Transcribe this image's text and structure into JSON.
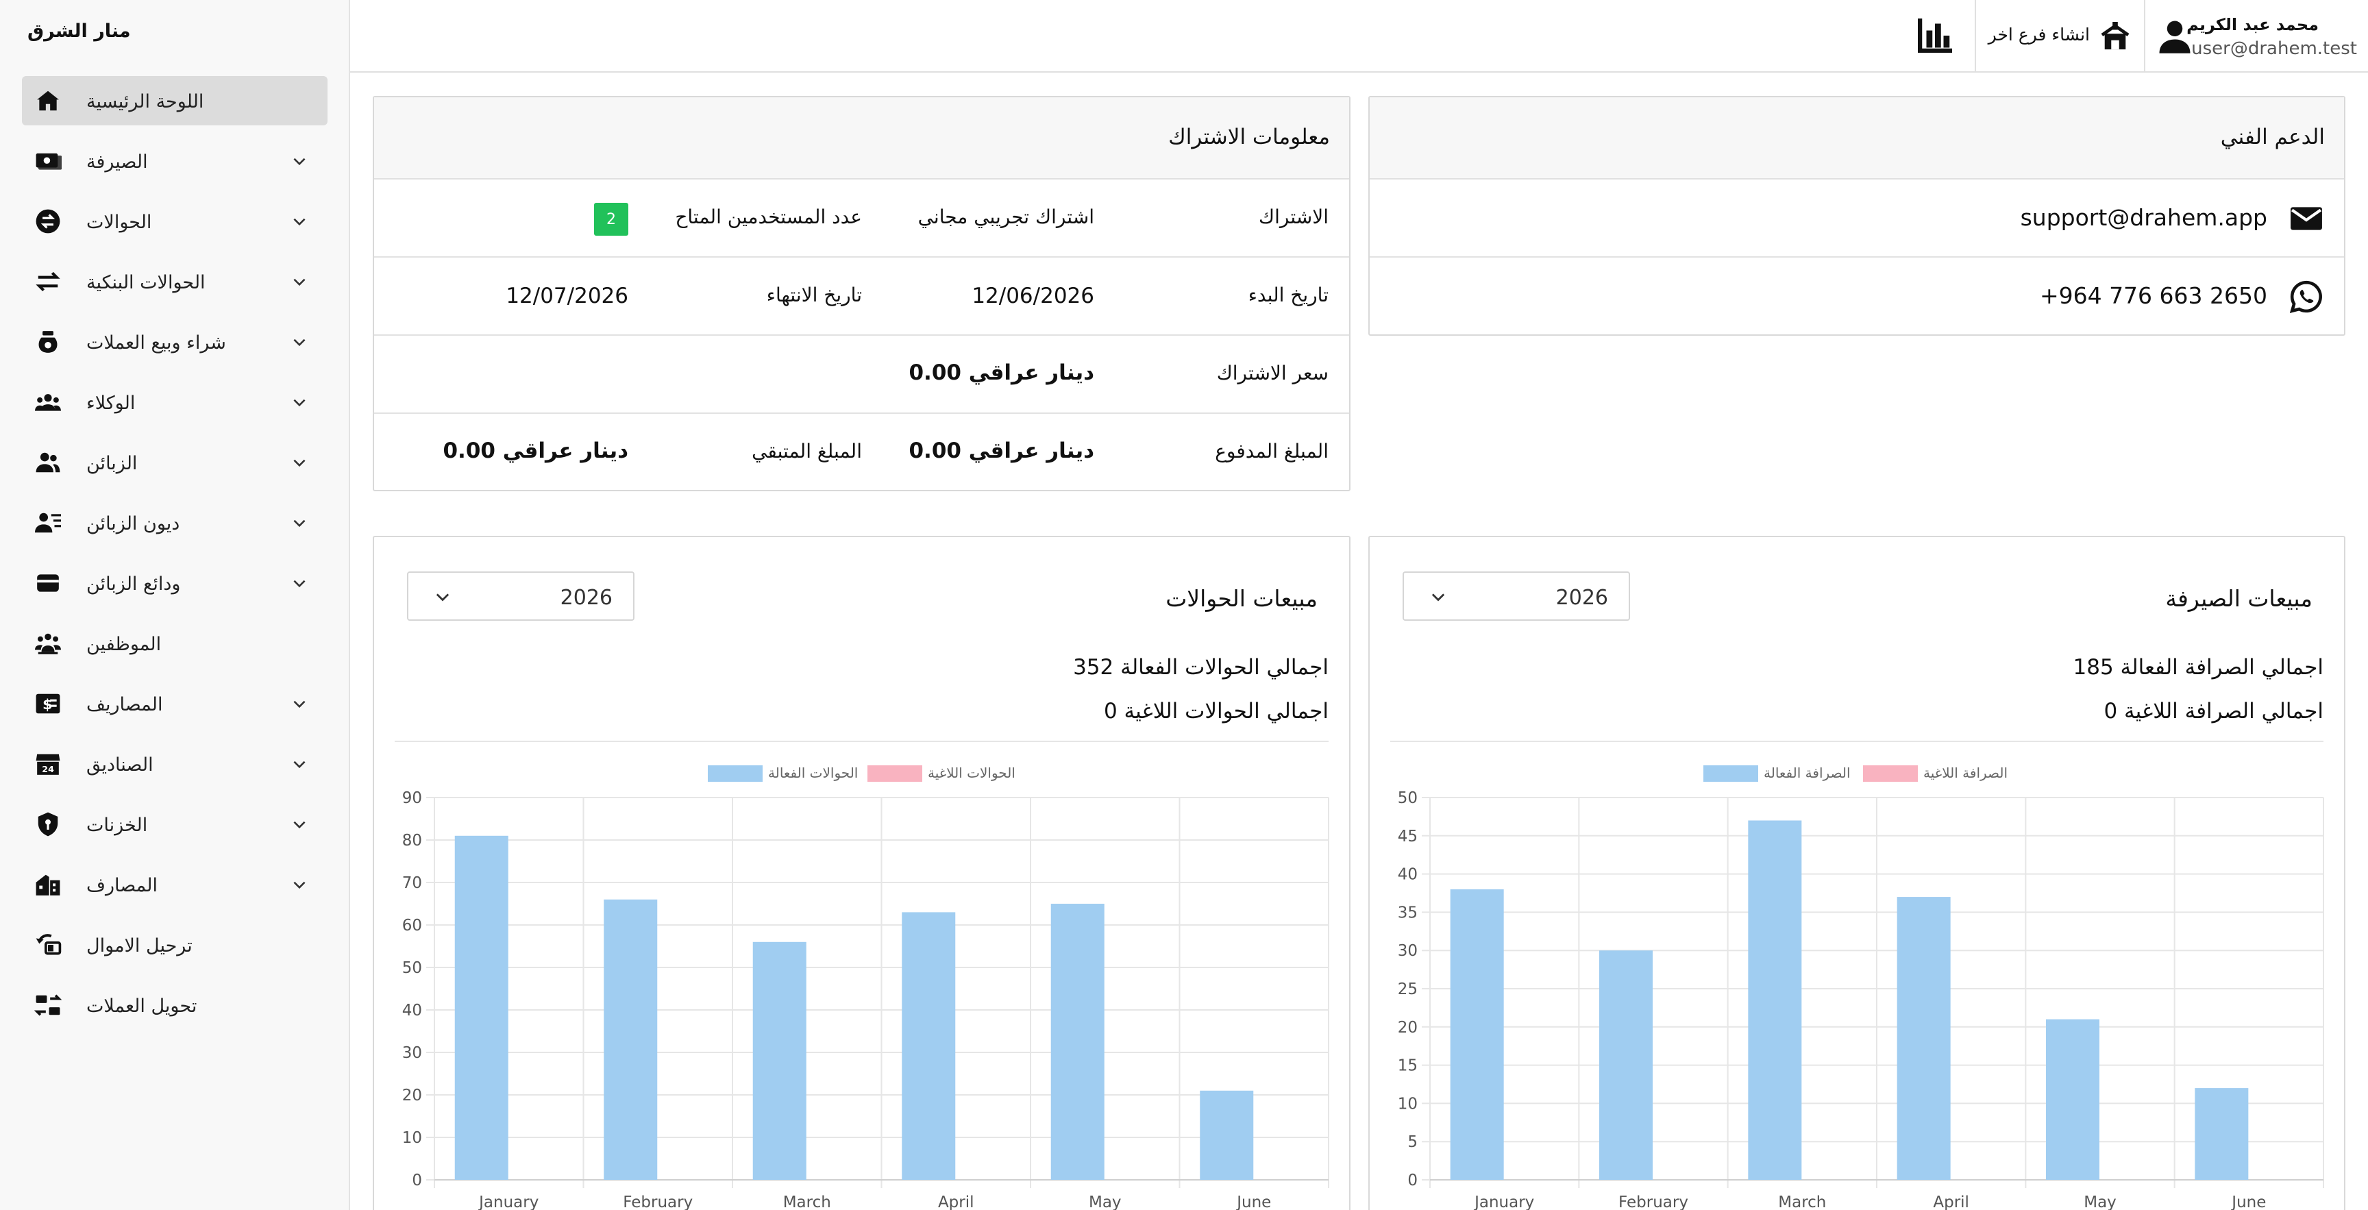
{
  "sidebar": {
    "brand": "منار الشرق",
    "items": [
      {
        "label": "اللوحة الرئيسية",
        "icon": "home-icon",
        "expandable": false,
        "active": true
      },
      {
        "label": "الصيرفة",
        "icon": "money-icon",
        "expandable": true
      },
      {
        "label": "الحوالات",
        "icon": "transfer-circle-icon",
        "expandable": true
      },
      {
        "label": "الحوالات البنكية",
        "icon": "swap-arrows-icon",
        "expandable": true
      },
      {
        "label": "شراء وبيع العملات",
        "icon": "money-bag-icon",
        "expandable": true
      },
      {
        "label": "الوكلاء",
        "icon": "agents-icon",
        "expandable": true
      },
      {
        "label": "الزبائن",
        "icon": "customers-icon",
        "expandable": true
      },
      {
        "label": "ديون الزبائن",
        "icon": "customer-debts-icon",
        "expandable": true
      },
      {
        "label": "ودائع الزبائن",
        "icon": "wallet-icon",
        "expandable": true
      },
      {
        "label": "الموظفين",
        "icon": "employees-icon",
        "expandable": false
      },
      {
        "label": "المصاريف",
        "icon": "expenses-icon",
        "expandable": true
      },
      {
        "label": "الصناديق",
        "icon": "store-icon",
        "expandable": true
      },
      {
        "label": "الخزنات",
        "icon": "shield-icon",
        "expandable": true
      },
      {
        "label": "المصارف",
        "icon": "bank-building-icon",
        "expandable": true
      },
      {
        "label": "ترحيل الاموال",
        "icon": "money-move-icon",
        "expandable": false
      },
      {
        "label": "تحويل العملات",
        "icon": "currency-exchange-icon",
        "expandable": false
      }
    ]
  },
  "header": {
    "user_name": "محمد عبد الكريم",
    "user_email": "user@drahem.test",
    "create_branch_label": "انشاء فرع اخر"
  },
  "subscription": {
    "title": "معلومات الاشتراك",
    "subscription_label": "الاشتراك",
    "subscription_value": "اشتراك تجريبي مجاني",
    "users_label": "عدد المستخدمين المتاح",
    "users_value": "2",
    "start_label": "تاريخ البدء",
    "start_value": "12/06/2026",
    "end_label": "تاريخ الانتهاء",
    "end_value": "12/07/2026",
    "price_label": "سعر الاشتراك",
    "price_value": "0.00  دينار عراقي",
    "paid_label": "المبلغ المدفوع",
    "paid_value": "0.00  دينار عراقي",
    "remaining_label": "المبلغ المتبقي",
    "remaining_value": "0.00  دينار عراقي"
  },
  "support": {
    "title": "الدعم الفني",
    "email": "support@drahem.app",
    "phone": "+964 776 663 2650"
  },
  "transfers_card": {
    "title": "مبيعات الحوالات",
    "year": "2026",
    "total_active": "اجمالي الحوالات الفعالة 352",
    "total_cancelled": "اجمالي الحوالات اللاغية 0"
  },
  "exchange_card": {
    "title": "مبيعات الصيرفة",
    "year": "2026",
    "total_active": "اجمالي الصرافة الفعالة 185",
    "total_cancelled": "اجمالي الصرافة اللاغية 0"
  },
  "colors": {
    "active_bar": "#a0cdf1",
    "cancelled_bar": "#f9b3c0",
    "badge_green": "#21c15a"
  },
  "chart_data": [
    {
      "type": "bar",
      "categories": [
        "January",
        "February",
        "March",
        "April",
        "May",
        "June"
      ],
      "series": [
        {
          "name": "الحوالات الفعالة",
          "values": [
            81,
            66,
            56,
            63,
            65,
            21
          ]
        },
        {
          "name": "الحوالات اللاغية",
          "values": [
            0,
            0,
            0,
            0,
            0,
            0
          ]
        }
      ],
      "ylim": [
        0,
        90
      ],
      "yticks": [
        0,
        10,
        20,
        30,
        40,
        50,
        60,
        70,
        80,
        90
      ],
      "grid": true,
      "legend": "top-center"
    },
    {
      "type": "bar",
      "categories": [
        "January",
        "February",
        "March",
        "April",
        "May",
        "June"
      ],
      "series": [
        {
          "name": "الصرافة الفعالة",
          "values": [
            38,
            30,
            47,
            37,
            21,
            12
          ]
        },
        {
          "name": "الصرافة اللاغية",
          "values": [
            0,
            0,
            0,
            0,
            0,
            0
          ]
        }
      ],
      "ylim": [
        0,
        50
      ],
      "yticks": [
        0,
        5,
        10,
        15,
        20,
        25,
        30,
        35,
        40,
        45,
        50
      ],
      "grid": true,
      "legend": "top-center"
    }
  ]
}
